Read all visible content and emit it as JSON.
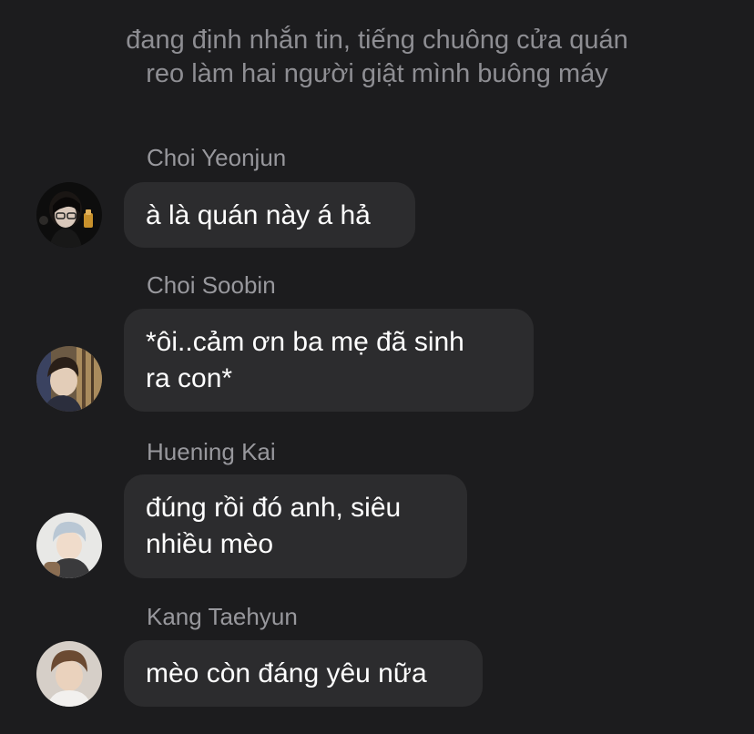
{
  "narration": {
    "line1": "đang định nhắn tin, tiếng chuông cửa quán",
    "line2": "reo làm hai người giật mình buông máy"
  },
  "messages": [
    {
      "sender": "Choi Yeonjun",
      "lines": [
        "à là quán này á hả"
      ],
      "avatar_icon": "avatar-yeonjun"
    },
    {
      "sender": "Choi Soobin",
      "lines": [
        "*ôi..cảm ơn ba mẹ đã sinh",
        "ra con*"
      ],
      "avatar_icon": "avatar-soobin"
    },
    {
      "sender": "Huening Kai",
      "lines": [
        "đúng rồi đó anh, siêu",
        "nhiều mèo"
      ],
      "avatar_icon": "avatar-hueningkai"
    },
    {
      "sender": "Kang Taehyun",
      "lines": [
        "mèo còn đáng yêu nữa"
      ],
      "avatar_icon": "avatar-taehyun"
    }
  ],
  "colors": {
    "background": "#1c1c1e",
    "bubble": "#2c2c2e",
    "secondary_text": "#8e8e93",
    "text": "#ffffff"
  }
}
